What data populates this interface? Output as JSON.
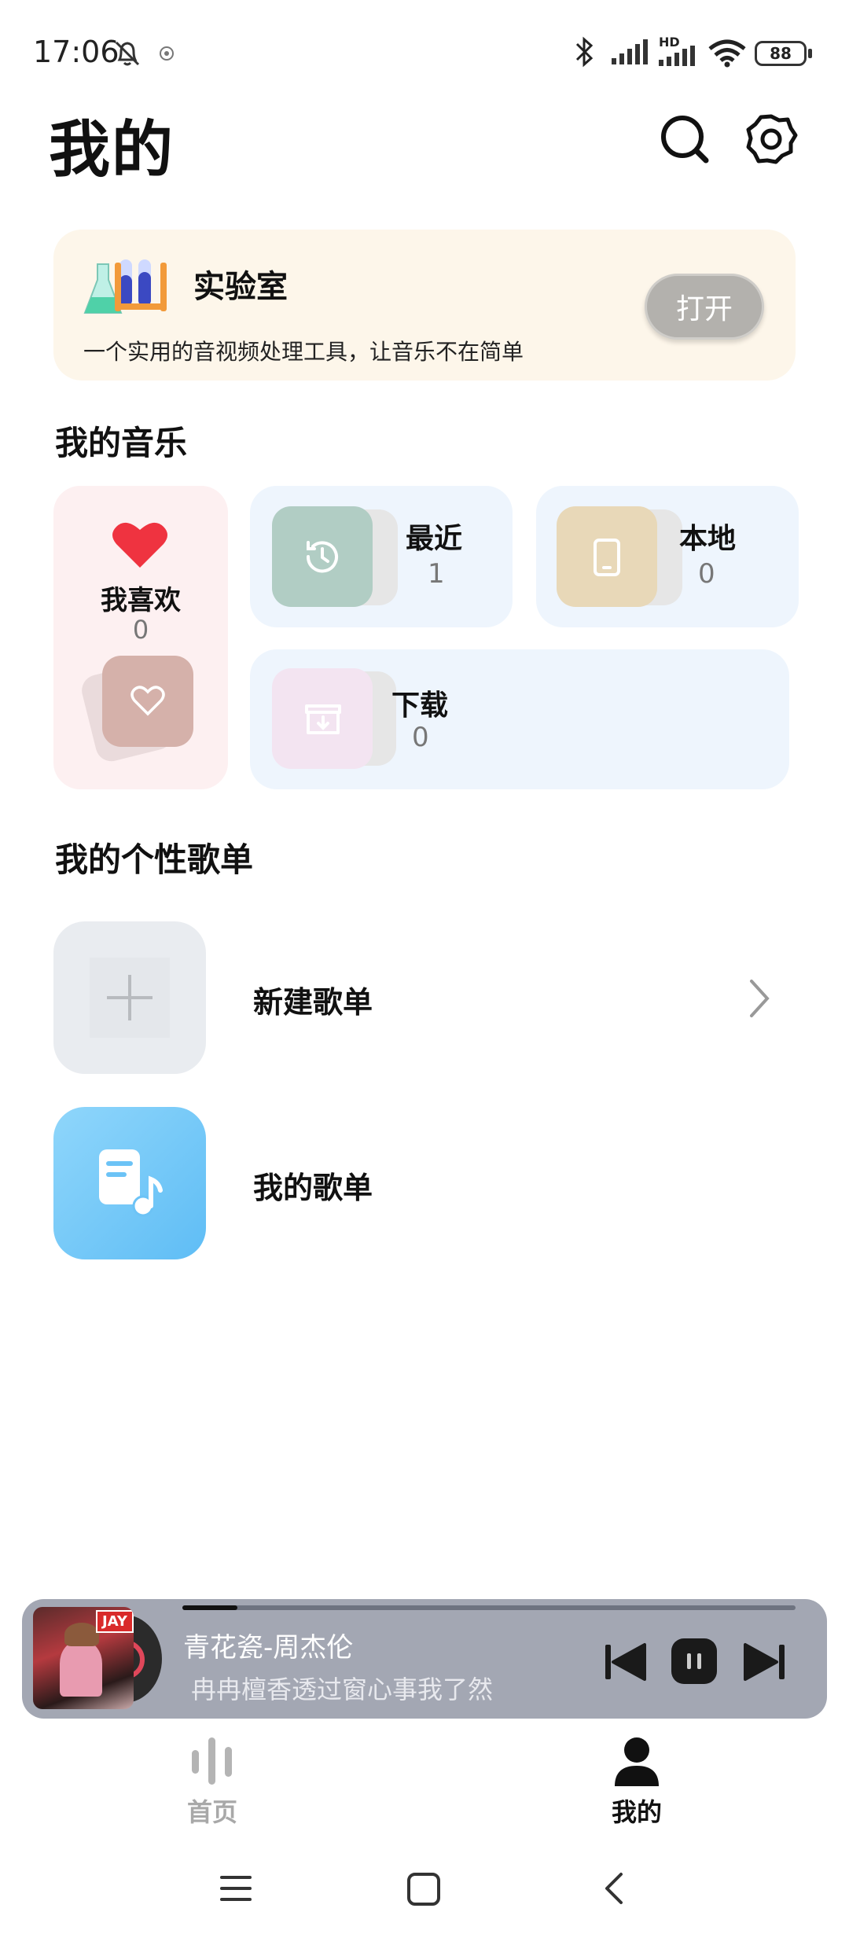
{
  "status_bar": {
    "time": "17:06",
    "battery": "88",
    "network_badge": "HD"
  },
  "header": {
    "title": "我的",
    "search_icon": "search-icon",
    "settings_icon": "gear-icon"
  },
  "lab": {
    "title": "实验室",
    "description": "一个实用的音视频处理工具，让音乐不在简单",
    "open_button": "打开"
  },
  "my_music": {
    "section_title": "我的音乐",
    "favorites": {
      "label": "我喜欢",
      "count": "0"
    },
    "recent": {
      "label": "最近",
      "count": "1"
    },
    "local": {
      "label": "本地",
      "count": "0"
    },
    "downloads": {
      "label": "下载",
      "count": "0"
    }
  },
  "playlists": {
    "section_title": "我的个性歌单",
    "items": [
      {
        "label": "新建歌单"
      },
      {
        "label": "我的歌单"
      }
    ]
  },
  "player": {
    "title": "青花瓷-周杰伦",
    "lyric": "冉冉檀香透过窗心事我了然",
    "album_badge": "JAY",
    "progress": 0.09
  },
  "bottom_nav": {
    "items": [
      {
        "label": "首页",
        "active": false
      },
      {
        "label": "我的",
        "active": true
      }
    ]
  },
  "colors": {
    "accent_red": "#ef3340",
    "lab_card_bg": "#fdf6ea",
    "tile_blue_bg": "#eef5fd",
    "tile_pink_bg": "#fdf0f1",
    "player_bg": "#a3a7b3"
  }
}
